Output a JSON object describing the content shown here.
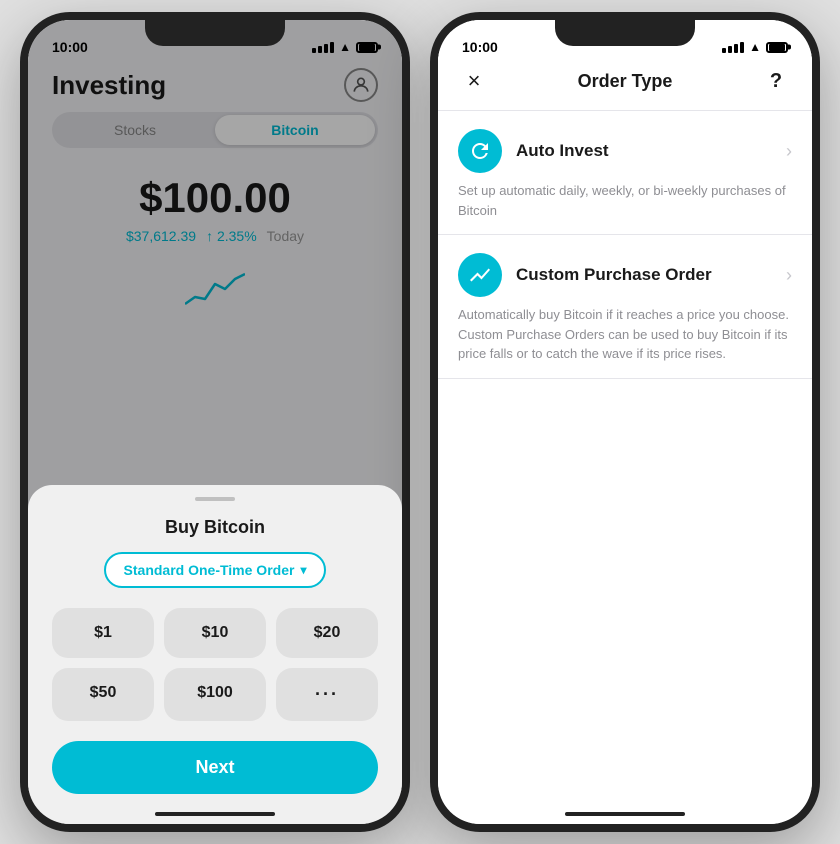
{
  "left_phone": {
    "status_time": "10:00",
    "header_title": "Investing",
    "tabs": [
      {
        "label": "Stocks",
        "active": false
      },
      {
        "label": "Bitcoin",
        "active": true
      }
    ],
    "main_price": "$100.00",
    "btc_price": "$37,612.39",
    "change": "↑ 2.35%",
    "period": "Today",
    "sheet": {
      "title": "Buy Bitcoin",
      "order_type": "Standard One-Time Order",
      "amounts": [
        "$1",
        "$10",
        "$20",
        "$50",
        "$100",
        "···"
      ],
      "next_label": "Next"
    }
  },
  "right_phone": {
    "status_time": "10:00",
    "header_title": "Order Type",
    "close_label": "×",
    "help_label": "?",
    "options": [
      {
        "label": "Auto Invest",
        "desc": "Set up automatic daily, weekly, or bi-weekly purchases of Bitcoin",
        "icon_type": "refresh"
      },
      {
        "label": "Custom Purchase Order",
        "desc": "Automatically buy Bitcoin if it reaches a price you choose. Custom Purchase Orders can be used to buy Bitcoin if its price falls or to catch the wave if its price rises.",
        "icon_type": "chart"
      }
    ]
  }
}
